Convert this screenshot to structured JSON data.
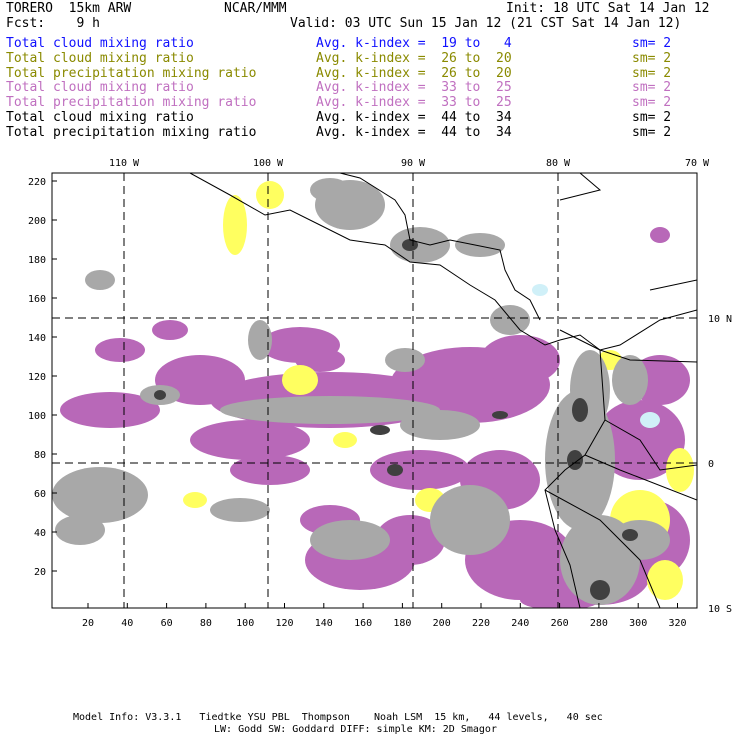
{
  "header": {
    "model": "TORERO  15km ARW",
    "org": "NCAR/MMM",
    "init": "Init: 18 UTC Sat 14 Jan 12",
    "fcst": "Fcst:    9 h",
    "valid": "Valid: 03 UTC Sun 15 Jan 12 (21 CST Sat 14 Jan 12)"
  },
  "legend": [
    {
      "field": "Total cloud mixing ratio",
      "kindex": "Avg. k-index =  19 to   4",
      "sm": "sm= 2",
      "color": "#1010ff"
    },
    {
      "field": "Total cloud mixing ratio",
      "kindex": "Avg. k-index =  26 to  20",
      "sm": "sm= 2",
      "color": "#8a8a00"
    },
    {
      "field": "Total precipitation mixing ratio",
      "kindex": "Avg. k-index =  26 to  20",
      "sm": "sm= 2",
      "color": "#8a8a00"
    },
    {
      "field": "Total cloud mixing ratio",
      "kindex": "Avg. k-index =  33 to  25",
      "sm": "sm= 2",
      "color": "#c070c0"
    },
    {
      "field": "Total precipitation mixing ratio",
      "kindex": "Avg. k-index =  33 to  25",
      "sm": "sm= 2",
      "color": "#c070c0"
    },
    {
      "field": "Total cloud mixing ratio",
      "kindex": "Avg. k-index =  44 to  34",
      "sm": "sm= 2",
      "color": "#000000"
    },
    {
      "field": "Total precipitation mixing ratio",
      "kindex": "Avg. k-index =  44 to  34",
      "sm": "sm= 2",
      "color": "#000000"
    }
  ],
  "axes": {
    "x_ticks": [
      "20",
      "40",
      "60",
      "80",
      "100",
      "120",
      "140",
      "160",
      "180",
      "200",
      "220",
      "240",
      "260",
      "280",
      "300",
      "320"
    ],
    "y_ticks": [
      "20",
      "40",
      "60",
      "80",
      "100",
      "120",
      "140",
      "160",
      "180",
      "200",
      "220"
    ],
    "lon_labels": [
      "110 W",
      "100 W",
      "90 W",
      "80 W",
      "70 W"
    ],
    "lat_labels": [
      "10 N",
      "0",
      "10 S"
    ]
  },
  "colors": {
    "purple": "#b868b8",
    "gray": "#a8a8a8",
    "yellow": "#ffff60",
    "dark": "#404040",
    "cyan": "#d0f0f8"
  },
  "footer": {
    "line1": "Model Info: V3.3.1   Tiedtke YSU PBL  Thompson    Noah LSM  15 km,   44 levels,   40 sec",
    "line2": "LW: Godd SW: Goddard DIFF: simple KM: 2D Smagor"
  }
}
